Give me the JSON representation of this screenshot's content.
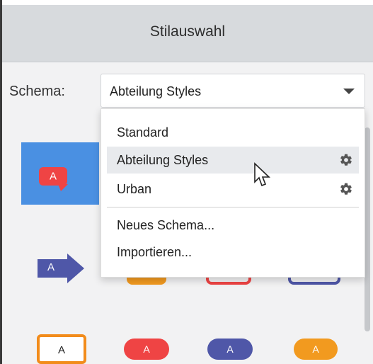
{
  "window": {
    "title": "Stilauswahl"
  },
  "schema": {
    "label": "Schema:",
    "selected": "Abteilung Styles"
  },
  "dropdown": {
    "items": [
      {
        "label": "Standard",
        "has_settings": false
      },
      {
        "label": "Abteilung Styles",
        "has_settings": true,
        "hover": true
      },
      {
        "label": "Urban",
        "has_settings": true
      }
    ],
    "actions": [
      {
        "label": "Neues Schema..."
      },
      {
        "label": "Importieren..."
      }
    ]
  },
  "gallery": {
    "row1": [
      {
        "text": "A",
        "color": "#ef4444",
        "shape": "speech-bubble"
      }
    ],
    "row2": [
      {
        "text": "A",
        "color": "#4f57a8",
        "shape": "arrow"
      }
    ],
    "row3": [
      {
        "text": "A",
        "color": "#f28c1b",
        "shape": "outlined-box"
      },
      {
        "text": "A",
        "color": "#ef4444",
        "shape": "pill"
      },
      {
        "text": "A",
        "color": "#4f57a8",
        "shape": "pill"
      },
      {
        "text": "A",
        "color": "#f29a1f",
        "shape": "pill"
      }
    ]
  },
  "colors": {
    "accent": "#4a90e2",
    "red": "#ef4444",
    "blue": "#4f57a8",
    "orange": "#f28c1b"
  }
}
